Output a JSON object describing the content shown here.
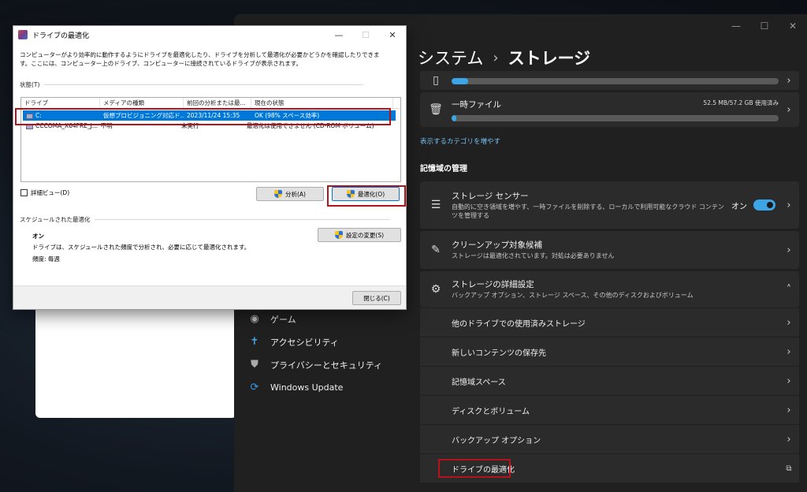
{
  "dialog": {
    "title": "ドライブの最適化",
    "description": "コンピューターがより効率的に動作するようにドライブを最適化したり、ドライブを分析して最適化が必要かどうかを確認したりできます。ここには、コンピューター上のドライブ、コンピューターに接続されているドライブが表示されます。",
    "status_label": "状態(T)",
    "columns": [
      "ドライブ",
      "メディアの種類",
      "前回の分析または最...",
      "現在の状態"
    ],
    "drives": [
      {
        "drive": "C:",
        "media": "仮想プロビジョニング対応ド...",
        "last": "2023/11/24 15:35",
        "status": "OK (98% スペース効率)"
      },
      {
        "drive": "CCCOMA_X64FRE_J...",
        "media": "不明",
        "last": "未実行",
        "status": "最適化は使用できません (CD-ROM ボリューム)"
      }
    ],
    "advanced_view": "詳細ビュー(D)",
    "analyze_button": "分析(A)",
    "optimize_button": "最適化(O)",
    "scheduled_label": "スケジュールされた最適化",
    "schedule_state": "オン",
    "schedule_desc": "ドライブは、スケジュールされた頻度で分析され、必要に応じて最適化されます。",
    "frequency": "頻度: 毎週",
    "change_settings_button": "設定の変更(S)",
    "close_button": "閉じる(C)"
  },
  "settings": {
    "breadcrumb_parent": "システム",
    "breadcrumb_current": "ストレージ",
    "breadcrumb_sep": "›",
    "top_usage_fraction": 0.05,
    "temp_files": {
      "title": "一時ファイル",
      "usage": "52.5 MB/57.2 GB 使用済み",
      "usage_fraction": 0.01
    },
    "show_more": "表示するカテゴリを増やす",
    "section_title": "記憶域の管理",
    "storage_sense": {
      "title": "ストレージ センサー",
      "subtitle": "自動的に空き領域を増やす、一時ファイルを削除する、ローカルで利用可能なクラウド コンテンツを管理する",
      "toggle_label": "オン"
    },
    "cleanup": {
      "title": "クリーンアップ対象候補",
      "subtitle": "ストレージは最適化されています。対処は必要ありません"
    },
    "advanced": {
      "title": "ストレージの詳細設定",
      "subtitle": "バックアップ オプション、ストレージ スペース、その他のディスクおよびボリューム"
    },
    "sub_items": [
      "他のドライブでの使用済みストレージ",
      "新しいコンテンツの保存先",
      "記憶域スペース",
      "ディスクとボリューム",
      "バックアップ オプション"
    ],
    "defrag_item": "ドライブの最適化"
  },
  "nav": {
    "items": [
      {
        "label": "ゲーム",
        "icon": "gamepad-icon"
      },
      {
        "label": "アクセシビリティ",
        "icon": "accessibility-icon"
      },
      {
        "label": "プライバシーとセキュリティ",
        "icon": "shield-icon"
      },
      {
        "label": "Windows Update",
        "icon": "windows-update-icon"
      }
    ]
  }
}
